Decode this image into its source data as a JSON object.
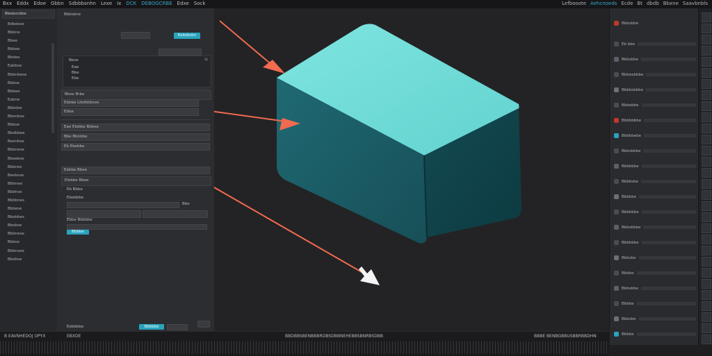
{
  "top_menu": [
    "Bxx",
    "Eddx",
    "Edoe",
    "Gbbn",
    "Sdbbbsnhn",
    "Lexe",
    "Ix",
    "DCK",
    "DEBOGCRBE",
    "Edxe",
    "Sock"
  ],
  "top_right": [
    "Lefbooote",
    "Aehcnoeds",
    "Ecde",
    "Bt",
    "dbdb",
    "Bbxne",
    "Saavbnbls"
  ],
  "outliner": {
    "header": "Bbebsnbbe",
    "items": [
      "Bdbebse",
      "Bbbne",
      "Bbee",
      "Bbbee",
      "Bbdee",
      "Eabbse",
      "Bbbnbese",
      "Bbbse",
      "Bbbee",
      "Eabne",
      "Bbbdse",
      "Bbenbse",
      "Bbbse",
      "Bbdbbee",
      "Beenbse",
      "Bbbnese",
      "Bbeebse",
      "Bbbnes",
      "Beebsse",
      "Bbbnee",
      "Bbbhse",
      "Bbbbnes",
      "Bbbese",
      "Bbebbes",
      "Bbebse",
      "Bbbnese",
      "Bbbse",
      "Bbbnsee",
      "Bbebse"
    ]
  },
  "props": {
    "top_label": "Bbbsbne",
    "apply_button": "Bsbsbsbo",
    "tree_lines": [
      "Bbxe",
      "Eae",
      "Bbe",
      "Ebe"
    ],
    "section1": "Bbxe Brbe",
    "field1": "Ebbbe Libdbbbsxe",
    "field2": "Ebbe",
    "field3": "Eae Elebbe Bbbee",
    "field4": "Bbe Bbnbbe",
    "field5": "Eb Ebebbe",
    "field6": "Eebbe Bbee",
    "section2": "Elebbe Bbee",
    "field7": "Eb Bbbe",
    "field8": "Ebebbbe",
    "inline_label": "Bbe",
    "field9": "Ebbe Bbbbbe",
    "cta": "Bbbbe",
    "bottom_left": "Eebbbbe",
    "bottom_btn": "Bbbbbe"
  },
  "right_panel": {
    "header": "Bbbsbbe",
    "rows": [
      "Eb bbe",
      "Bbbsbbe",
      "Bbbeabbbe",
      "Bbbbsbbbe",
      "Bbbebbe",
      "Bbbbbbbe",
      "Bbbbbebe",
      "Bbbsbbbe",
      "Bbbbbbe",
      "Bbbbsbe",
      "Bbbbbe",
      "Bbbbbbe",
      "Bbbsbbbe",
      "Bbbbbbe",
      "Bbbsbe",
      "Bbbbe",
      "Bbbsbbe",
      "Bbbbe",
      "Bbbsbe",
      "Bbbbe"
    ]
  },
  "timeline": {
    "left": "B EAVNHEDOJ OPYX",
    "mid": "EBXDE",
    "center": "BBDBBSBENBBBRDBSDBBNEHEBBSBNRBSDBB",
    "right": "BBBE BENBGBBUSBBRBBDHN"
  },
  "colors": {
    "accent": "#2aa3bd",
    "box_top": "#71dcd9",
    "box_front": "#1b5d66",
    "box_side": "#0f434b",
    "arrow": "#f06b4f",
    "cursor": "#f4f4f4"
  }
}
